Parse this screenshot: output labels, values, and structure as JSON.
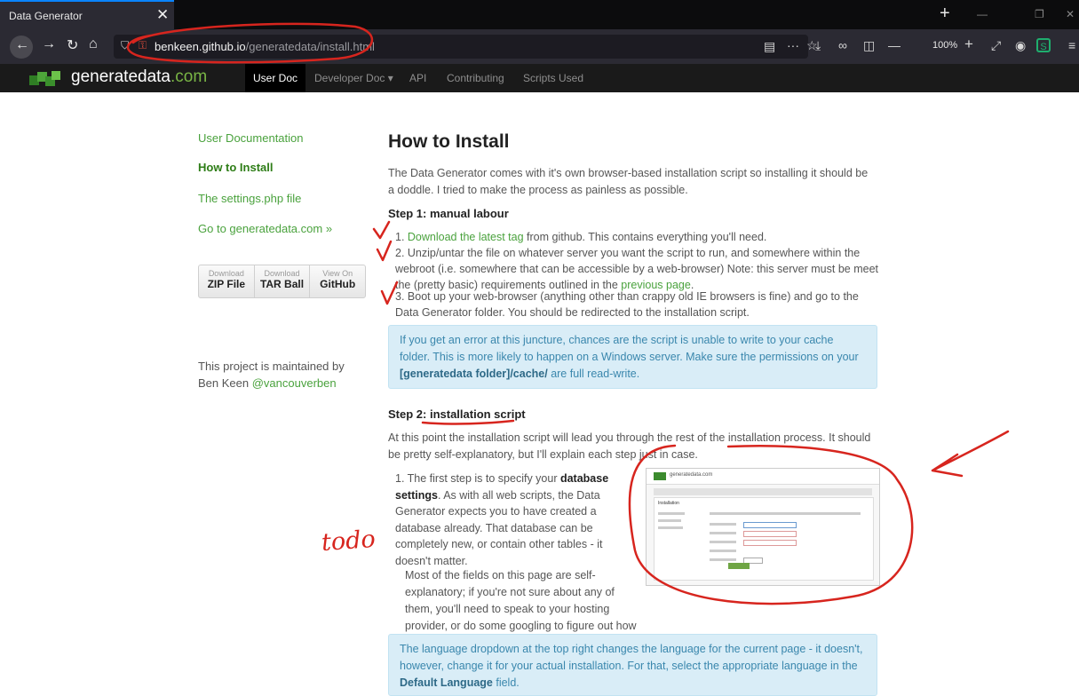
{
  "browser": {
    "tab_title": "Data Generator",
    "url_host": "benkeen.github.io",
    "url_path": "/generatedata/install.html",
    "zoom": "100%"
  },
  "site": {
    "brand": "generatedata",
    "brand_tld": ".com",
    "nav": [
      "User Doc",
      "Developer Doc ▾",
      "API",
      "Contributing",
      "Scripts Used"
    ]
  },
  "sidebar": {
    "links": [
      "User Documentation",
      "How to Install",
      "The settings.php file",
      "Go to generatedata.com »"
    ],
    "downloads": [
      {
        "small": "Download",
        "big": "ZIP File"
      },
      {
        "small": "Download",
        "big": "TAR Ball"
      },
      {
        "small": "View On",
        "big": "GitHub"
      }
    ],
    "maintained_text": "This project is maintained by Ben Keen",
    "maintained_handle": "@vancouverben"
  },
  "content": {
    "title": "How to Install",
    "intro": "The Data Generator comes with it's own browser-based installation script so installing it should be a doddle. I tried to make the process as painless as possible.",
    "step1_heading": "Step 1: manual labour",
    "step1_item1_link": "Download the latest tag",
    "step1_item1_text": " from github. This contains everything you'll need.",
    "step1_item2_text": "Unzip/untar the file on whatever server you want the script to run, and somewhere within the webroot (i.e. somewhere that can be accessible by a web-browser) Note: this server must be meet the (pretty basic) requirements outlined in the ",
    "step1_item2_link": "previous page",
    "step1_item3_text": "Boot up your web-browser (anything other than crappy old IE browsers is fine) and go to the Data Generator folder. You should be redirected to the installation script.",
    "info1_text": "If you get an error at this juncture, chances are the script is unable to write to your cache folder. This is more likely to happen on a Windows server. Make sure the permissions on your ",
    "info1_bold": "[generatedata folder]/cache/",
    "info1_tail": " are full read-write.",
    "step2_heading": "Step 2: installation script",
    "step2_intro": "At this point the installation script will lead you through the rest of the installation process. It should be pretty self-explanatory, but I'll explain each step just in case.",
    "step2_item1_a": "The first step is to specify your ",
    "step2_item1_bold": "database settings",
    "step2_item1_b": ". As with all web scripts, the Data Generator expects you to have created a database already. That database can be completely new, or contain other tables - it doesn't matter.",
    "step2_p2": "Most of the fields on this page are self-explanatory; if you're not sure about any of them, you'll need to speak to your hosting provider, or do some googling to figure out how to get it working locally.",
    "info2_text": "The language dropdown at the top right changes the language for the current page - it doesn't, however, change it for your actual installation. For that, select the appropriate language in the ",
    "info2_bold": "Default Language",
    "info2_tail": " field."
  },
  "thumbnail": {
    "brand": "generatedata.com",
    "heading": "Installation"
  },
  "annotation": {
    "todo": "todo",
    "ink_color": "#d7251e"
  }
}
